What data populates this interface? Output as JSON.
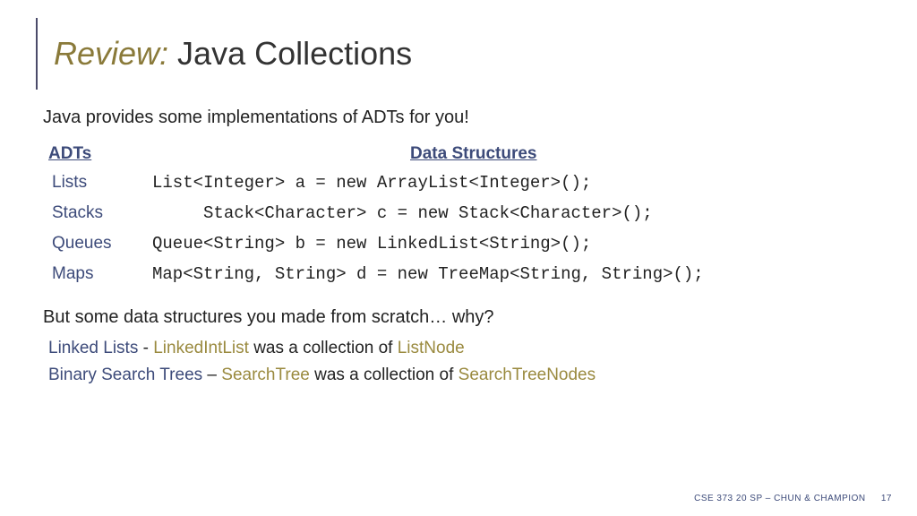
{
  "title": {
    "accent": "Review:",
    "main": " Java Collections"
  },
  "intro": "Java provides some implementations of ADTs for you!",
  "headers": {
    "adts": "ADTs",
    "ds": "Data Structures"
  },
  "rows": [
    {
      "adt": "Lists",
      "code": "List<Integer> a = new ArrayList<Integer>();"
    },
    {
      "adt": "Stacks",
      "code": "     Stack<Character> c = new Stack<Character>();"
    },
    {
      "adt": "Queues",
      "code": "Queue<String> b = new LinkedList<String>();"
    },
    {
      "adt": "Maps",
      "code": "Map<String, String> d = new TreeMap<String, String>();"
    }
  ],
  "question": "But some data structures you made from scratch… why?",
  "scratch": [
    {
      "label": "Linked Lists",
      "sep": " - ",
      "gold1": "LinkedIntList",
      "mid": " was a collection of ",
      "gold2": "ListNode"
    },
    {
      "label": "Binary Search Trees",
      "sep": " – ",
      "gold1": "SearchTree",
      "mid": " was a collection of ",
      "gold2": "SearchTreeNodes"
    }
  ],
  "footer": {
    "course": "CSE 373 20 SP – CHUN & CHAMPION",
    "slide": "17"
  }
}
